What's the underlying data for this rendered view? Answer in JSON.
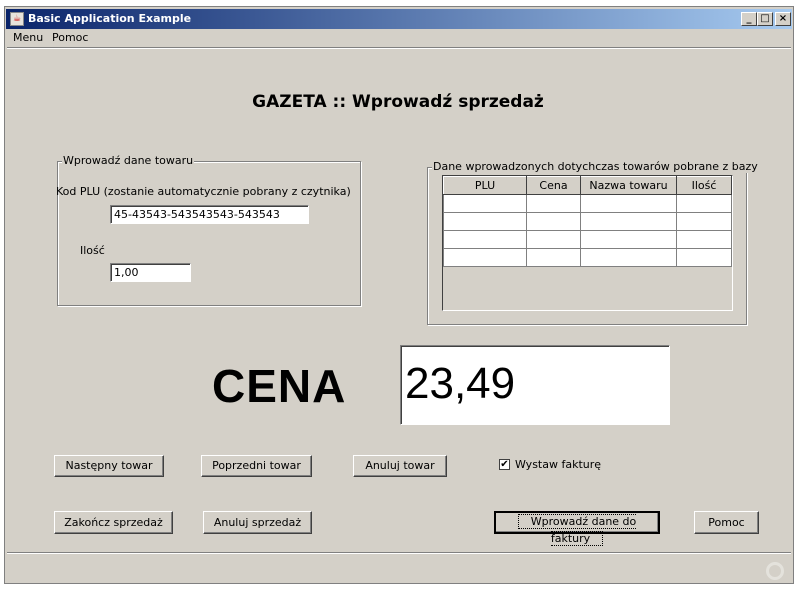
{
  "window": {
    "title": "Basic Application Example",
    "controls": [
      "_",
      "□",
      "×"
    ]
  },
  "menu": [
    "Menu",
    "Pomoc"
  ],
  "heading": "GAZETA :: Wprowadź sprzedaż",
  "product_group": {
    "legend": "Wprowadź dane towaru",
    "plu_label": "Kod PLU (zostanie automatycznie pobrany z czytnika)",
    "plu_value": "45-43543-543543543-543543",
    "qty_label": "Ilość",
    "qty_value": "1,00"
  },
  "table_group": {
    "legend": "Dane wprowadzonych dotychczas towarów pobrane z bazy",
    "columns": [
      "PLU",
      "Cena",
      "Nazwa towaru",
      "Ilość"
    ],
    "rows": [
      [
        "",
        "",
        "",
        ""
      ],
      [
        "",
        "",
        "",
        ""
      ],
      [
        "",
        "",
        "",
        ""
      ],
      [
        "",
        "",
        "",
        ""
      ]
    ]
  },
  "price": {
    "label": "CENA",
    "value": "23,49"
  },
  "buttons": {
    "next": "Następny towar",
    "prev": "Poprzedni towar",
    "cancel_item": "Anuluj towar",
    "finish": "Zakończ sprzedaż",
    "cancel_sale": "Anuluj sprzedaż",
    "invoice_data": "Wprowadź dane do faktury",
    "help": "Pomoc"
  },
  "invoice_checkbox": {
    "label": "Wystaw fakturę",
    "checked": true
  }
}
